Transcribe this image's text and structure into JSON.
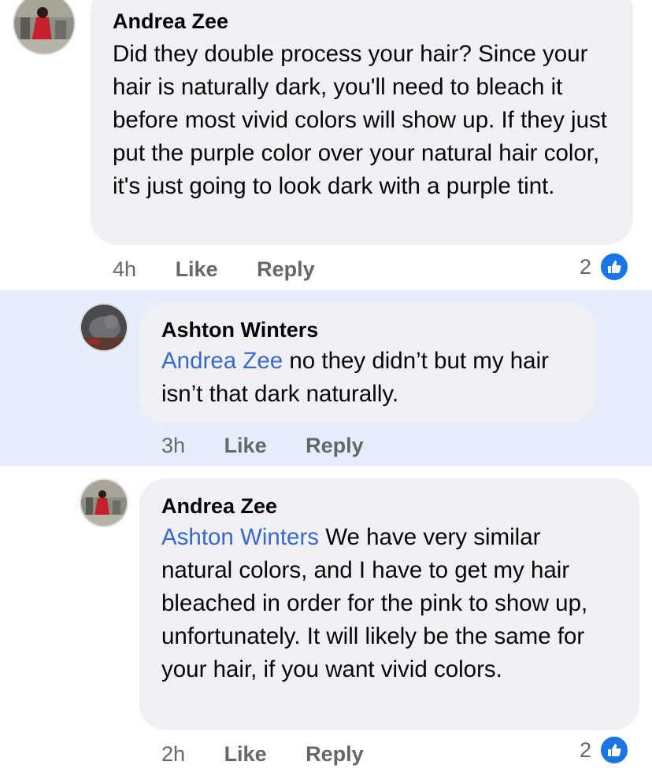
{
  "comments": [
    {
      "author": "Andrea Zee",
      "mention": "",
      "text": "Did they double process your hair? Since your hair is naturally dark, you'll need to bleach it before most vivid colors will show up. If they just put the purple color over your natural hair color, it's just going to look dark with a purple tint.",
      "time": "4h",
      "like_label": "Like",
      "reply_label": "Reply",
      "reaction_count": "2",
      "reaction_icon": "thumbs-up-icon"
    },
    {
      "author": "Ashton Winters",
      "mention": "Andrea Zee",
      "text": "no they didn’t but my hair isn’t that dark naturally.",
      "time": "3h",
      "like_label": "Like",
      "reply_label": "Reply",
      "reaction_count": "",
      "highlighted": true
    },
    {
      "author": "Andrea Zee",
      "mention": "Ashton Winters",
      "text": "We have very similar natural colors, and I have to get my hair bleached in order for the pink to show up, unfortunately. It will likely be the same for your hair, if you want vivid colors.",
      "time": "2h",
      "like_label": "Like",
      "reply_label": "Reply",
      "reaction_count": "2",
      "reaction_icon": "thumbs-up-icon"
    }
  ],
  "colors": {
    "mention": "#3b69c9",
    "highlight": "#e7eefb",
    "bubble": "#f0f1f4",
    "like_badge": "#1b74e4"
  }
}
